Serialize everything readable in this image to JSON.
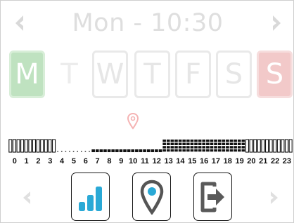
{
  "header": {
    "title": "Mon - 10:30",
    "prev_icon": "chevron-left-icon",
    "next_icon": "chevron-right-icon"
  },
  "days": [
    {
      "letter": "M",
      "state": "selected-weekday",
      "color": "#bfe2c0"
    },
    {
      "letter": "T",
      "state": "no-frame"
    },
    {
      "letter": "W",
      "state": "framed"
    },
    {
      "letter": "T",
      "state": "framed"
    },
    {
      "letter": "F",
      "state": "framed"
    },
    {
      "letter": "S",
      "state": "framed"
    },
    {
      "letter": "S",
      "state": "weekend",
      "color": "#f2c9c9"
    }
  ],
  "location_icon": "map-pin-icon",
  "hour_bar": {
    "hours": [
      "0",
      "1",
      "2",
      "3",
      "4",
      "5",
      "6",
      "7",
      "8",
      "9",
      "10",
      "11",
      "12",
      "13",
      "14",
      "15",
      "16",
      "17",
      "18",
      "19",
      "20",
      "21",
      "22",
      "23"
    ],
    "levels": [
      "comfort",
      "comfort",
      "comfort",
      "comfort",
      "off",
      "off",
      "off",
      "eco",
      "eco",
      "eco",
      "eco",
      "eco",
      "eco",
      "boost",
      "boost",
      "boost",
      "boost",
      "boost",
      "boost",
      "boost",
      "comfort",
      "comfort",
      "comfort",
      "comfort"
    ]
  },
  "buttons": [
    {
      "name": "signal-button",
      "icon": "signal-bars-icon",
      "color": "#2aa9d6"
    },
    {
      "name": "location-button",
      "icon": "location-marker-icon",
      "color": "#2aa9d6"
    },
    {
      "name": "exit-button",
      "icon": "exit-icon",
      "color": "#5a5a5a"
    }
  ],
  "colors": {
    "disabled": "#dedede",
    "accent": "#2aa9d6",
    "pin": "#f5b4b4"
  }
}
